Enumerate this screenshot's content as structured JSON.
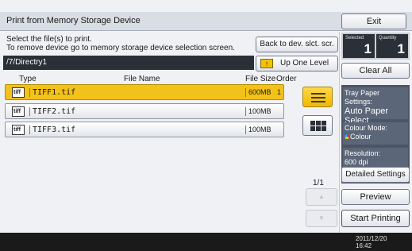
{
  "title_bar": {
    "title": "Print from Memory Storage Device",
    "exit_label": "Exit"
  },
  "instructions": {
    "line1": "Select the file(s) to print.",
    "line2": "To remove device go to memory storage device selection screen."
  },
  "back_button_label": "Back to dev. slct. scr.",
  "current_path": "/7/Directry1",
  "up_one_level_label": "Up One Level",
  "table": {
    "columns": {
      "type": "Type",
      "file_name": "File Name",
      "file_size": "File Size",
      "order": "Order"
    },
    "rows": [
      {
        "icon": "tiff-file-icon",
        "name": "TIFF1.tif",
        "size": "600MB",
        "order": "1",
        "selected": true
      },
      {
        "icon": "tiff-file-icon",
        "name": "TIFF2.tif",
        "size": "100MB",
        "order": "",
        "selected": false
      },
      {
        "icon": "tiff-file-icon",
        "name": "TIFF3.tif",
        "size": "100MB",
        "order": "",
        "selected": false
      }
    ]
  },
  "view_buttons": {
    "list_icon": "list-view-icon",
    "grid_icon": "grid-view-icon"
  },
  "pagination": {
    "indicator": "1/1"
  },
  "counts": {
    "selected_label": "Selected",
    "selected_value": "1",
    "quantity_label": "Quantity",
    "quantity_value": "1"
  },
  "clear_all_label": "Clear All",
  "settings": {
    "tray_label": "Tray Paper Settings:",
    "tray_value": "Auto Paper Select",
    "colour_label": "Colour Mode:",
    "colour_value": "Colour",
    "resolution_label": "Resolution:",
    "resolution_value": "600 dpi"
  },
  "detailed_settings_label": "Detailed Settings",
  "preview_label": "Preview",
  "start_printing_label": "Start Printing",
  "clock": {
    "date": "2011/12/20",
    "time": "16:42"
  },
  "colors": {
    "selected_row": "#f3c21a",
    "path_bar": "#2b2f37",
    "settings_panel": "#4b5566"
  }
}
